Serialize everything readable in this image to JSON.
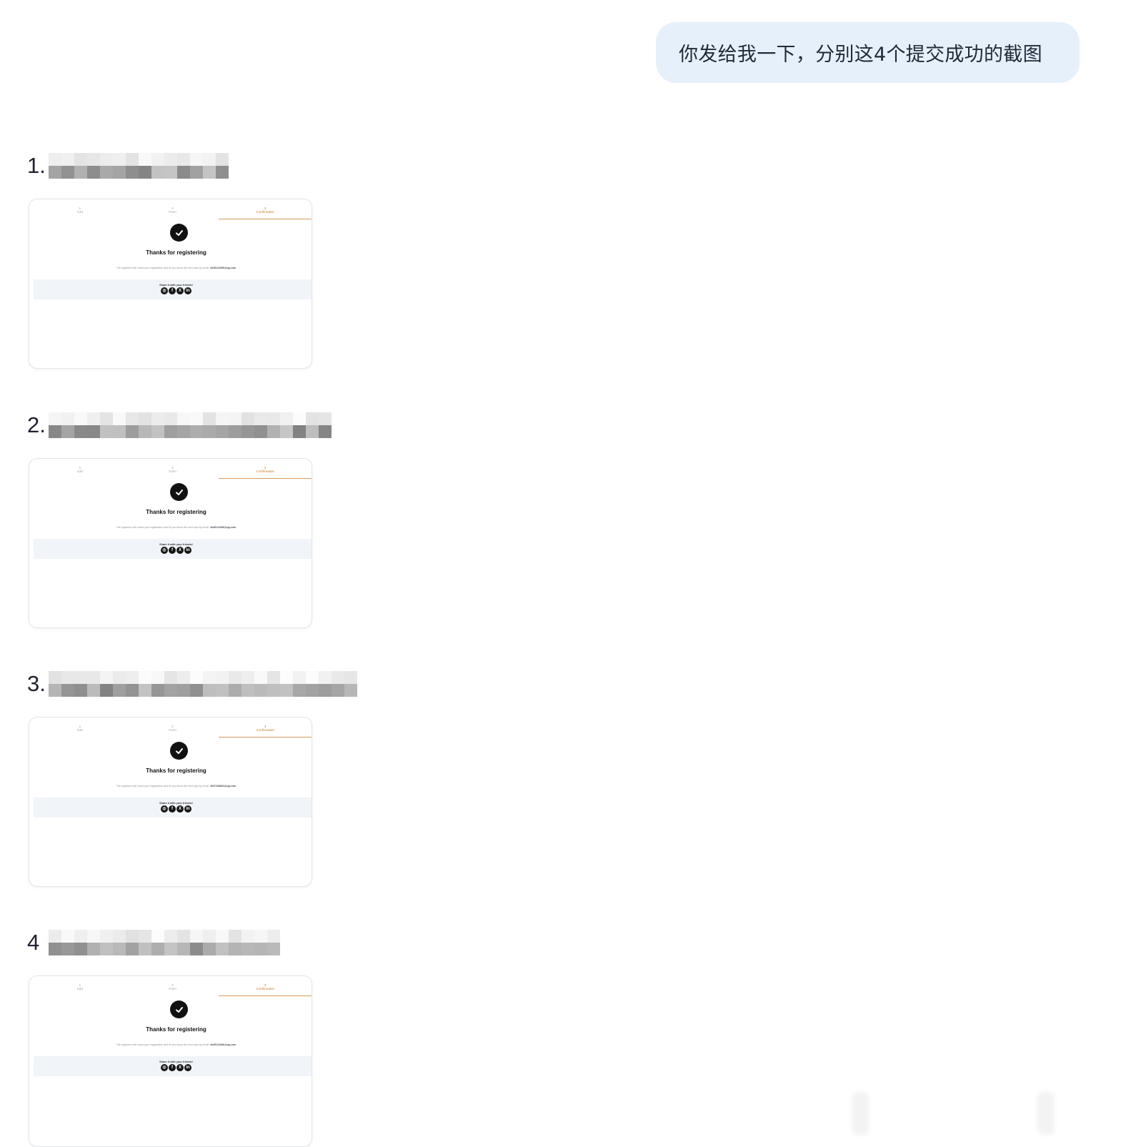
{
  "message": {
    "text": "你发给我一下，分别这4个提交成功的截图"
  },
  "items": [
    {
      "number": "1.",
      "steps": [
        {
          "num": "1",
          "label": "Cart"
        },
        {
          "num": "2",
          "label": "Form"
        },
        {
          "num": "3",
          "label": "Confirmation"
        }
      ],
      "check_icon": "check-circle-icon",
      "title": "Thanks for registering",
      "desc": "The organizer will check your registration and let you know the next step by email: ",
      "email": "4445123456@qq.com",
      "share_label": "Share it with your friends!",
      "social_icons": [
        "whatsapp-icon",
        "facebook-icon",
        "x-icon",
        "linkedin-icon"
      ]
    },
    {
      "number": "2.",
      "steps": [
        {
          "num": "1",
          "label": "Cart"
        },
        {
          "num": "2",
          "label": "Form"
        },
        {
          "num": "3",
          "label": "Confirmation"
        }
      ],
      "check_icon": "check-circle-icon",
      "title": "Thanks for registering",
      "desc": "The organizer will check your registration and let you know the next step by email: ",
      "email": "4445123456@qq.com",
      "share_label": "Share it with your friends!",
      "social_icons": [
        "whatsapp-icon",
        "facebook-icon",
        "x-icon",
        "linkedin-icon"
      ]
    },
    {
      "number": "3.",
      "steps": [
        {
          "num": "1",
          "label": "Cart"
        },
        {
          "num": "2",
          "label": "Form"
        },
        {
          "num": "3",
          "label": "Confirmation"
        }
      ],
      "check_icon": "check-circle-icon",
      "title": "Thanks for registering",
      "desc": "The organizer will check your registration and let you know the next step by email: ",
      "email": "4547238834@qq.com",
      "share_label": "Share it with your friends!",
      "social_icons": [
        "whatsapp-icon",
        "facebook-icon",
        "x-icon",
        "linkedin-icon"
      ]
    },
    {
      "number": "4",
      "steps": [
        {
          "num": "1",
          "label": "Cart"
        },
        {
          "num": "2",
          "label": "Form"
        },
        {
          "num": "3",
          "label": "Confirmation"
        }
      ],
      "check_icon": "check-circle-icon",
      "title": "Thanks for registering",
      "desc": "The organizer will check your registration and let you know the next step by email: ",
      "email": "4445123456@qq.com",
      "share_label": "Share it with your friends!",
      "social_icons": [
        "whatsapp-icon",
        "facebook-icon",
        "x-icon",
        "linkedin-icon"
      ]
    }
  ],
  "colors": {
    "bubble_bg": "#e6f0fb",
    "active_step": "#c27a2a",
    "share_band": "#f1f4f8"
  }
}
